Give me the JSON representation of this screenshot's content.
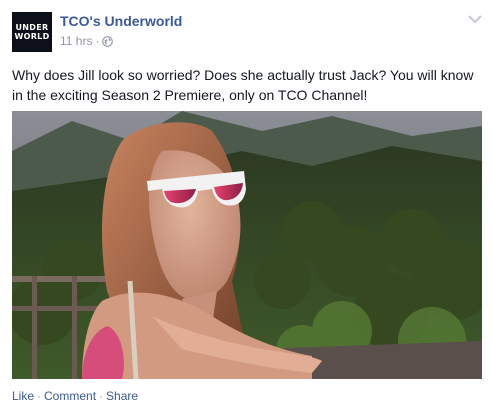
{
  "post": {
    "avatar_text": [
      "UNDER",
      "WORLD"
    ],
    "page_name": "TCO's Underworld",
    "timestamp": "11 hrs",
    "meta_separator": "·",
    "privacy_icon": "globe-icon",
    "options_icon": "chevron-down-icon",
    "message": "Why does Jill look so worried? Does she actually trust Jack? You will know in the exciting Season 2 Premiere, only on TCO Channel!",
    "photo_subject": "photo",
    "actions": {
      "like": "Like",
      "comment": "Comment",
      "share": "Share",
      "separator": "·"
    }
  },
  "colors": {
    "link": "#3b5998",
    "meta": "#9197a3",
    "text": "#141823"
  }
}
